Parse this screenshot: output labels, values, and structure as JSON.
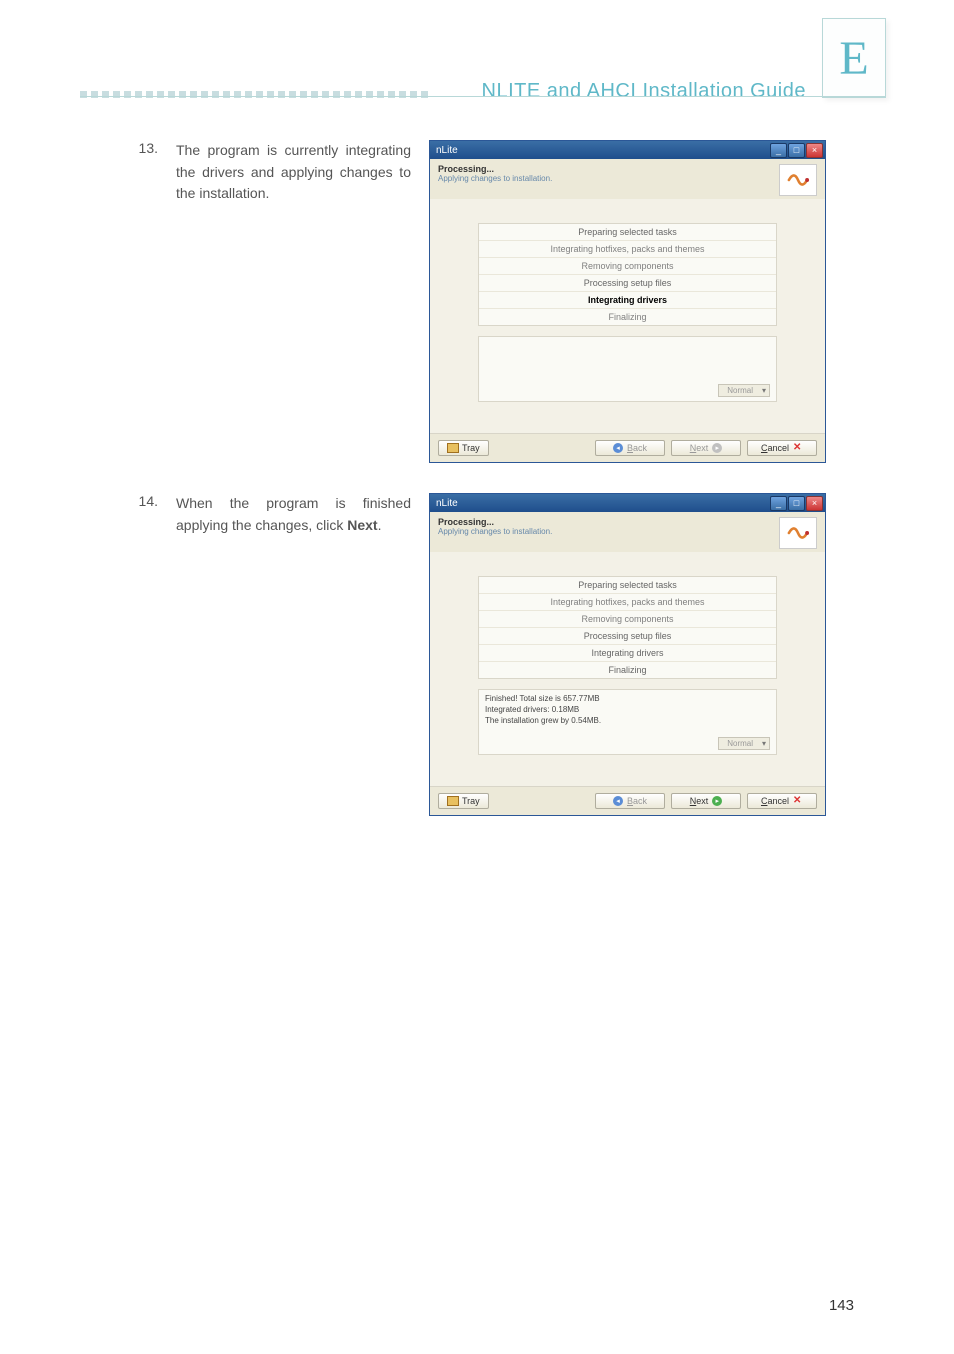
{
  "appendix_letter": "E",
  "header_title": "NLITE and AHCI Installation Guide",
  "page_number": "143",
  "steps": [
    {
      "num": "13.",
      "text_html": "The program is currently integrating the drivers and applying changes to the installation.",
      "window": {
        "title": "nLite",
        "proc_title": "Processing...",
        "proc_sub": "Applying changes to installation.",
        "tasks": [
          {
            "label": "Preparing selected tasks",
            "state": "done"
          },
          {
            "label": "Integrating hotfixes, packs and themes",
            "state": "idle"
          },
          {
            "label": "Removing components",
            "state": "idle"
          },
          {
            "label": "Processing setup files",
            "state": "done"
          },
          {
            "label": "Integrating drivers",
            "state": "active"
          },
          {
            "label": "Finalizing",
            "state": "idle"
          }
        ],
        "info_lines": [],
        "dropdown": "Normal",
        "tray": "Tray",
        "back": "Back",
        "next": "Next",
        "cancel": "Cancel",
        "back_enabled": false,
        "next_enabled": false
      }
    },
    {
      "num": "14.",
      "text_html": "When the program is finished applying the changes, click <b>Next</b>.",
      "window": {
        "title": "nLite",
        "proc_title": "Processing...",
        "proc_sub": "Applying changes to installation.",
        "tasks": [
          {
            "label": "Preparing selected tasks",
            "state": "done"
          },
          {
            "label": "Integrating hotfixes, packs and themes",
            "state": "idle"
          },
          {
            "label": "Removing components",
            "state": "idle"
          },
          {
            "label": "Processing setup files",
            "state": "done"
          },
          {
            "label": "Integrating drivers",
            "state": "done"
          },
          {
            "label": "Finalizing",
            "state": "done"
          }
        ],
        "info_lines": [
          "Finished! Total size is 657.77MB",
          "Integrated drivers: 0.18MB",
          "The installation grew by 0.54MB."
        ],
        "dropdown": "Normal",
        "tray": "Tray",
        "back": "Back",
        "next": "Next",
        "cancel": "Cancel",
        "back_enabled": false,
        "next_enabled": true
      }
    }
  ]
}
